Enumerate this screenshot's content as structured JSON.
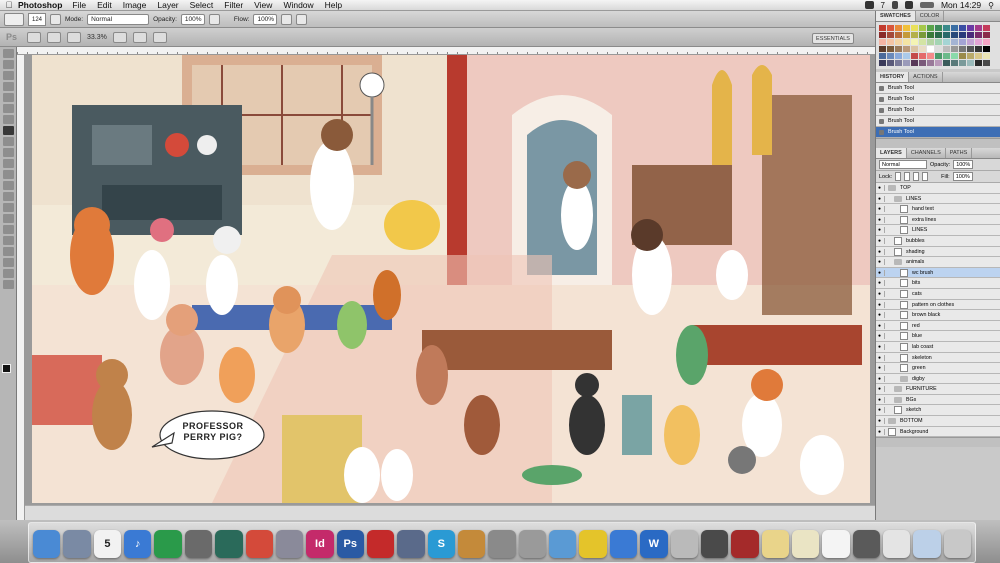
{
  "menubar": {
    "app_name": "Photoshop",
    "items": [
      "File",
      "Edit",
      "Image",
      "Layer",
      "Select",
      "Filter",
      "View",
      "Window",
      "Help"
    ],
    "clock": "Mon 14:29",
    "badge": "7"
  },
  "options_bar": {
    "brush_size": "124",
    "mode_label": "Mode:",
    "mode_value": "Normal",
    "opacity_label": "Opacity:",
    "opacity_value": "100%",
    "flow_label": "Flow:",
    "flow_value": "100%"
  },
  "app_bar": {
    "logo": "Ps",
    "zoom": "33.3%",
    "workspace": "ESSENTIALS"
  },
  "speech_bubble": "PROFESSOR PERRY PIG?",
  "panels": {
    "swatch_tabs": [
      "SWATCHES",
      "COLOR"
    ],
    "history_tabs": [
      "HISTORY",
      "ACTIONS"
    ],
    "history_items": [
      "Brush Tool",
      "Brush Tool",
      "Brush Tool",
      "Brush Tool",
      "Brush Tool"
    ],
    "layers_tabs": [
      "LAYERS",
      "CHANNELS",
      "PATHS"
    ],
    "blend_mode": "Normal",
    "opacity_label": "Opacity:",
    "opacity": "100%",
    "lock_label": "Lock:",
    "fill_label": "Fill:",
    "fill": "100%",
    "layers": [
      {
        "name": "TOP",
        "indent": 0,
        "group": true
      },
      {
        "name": "LINES",
        "indent": 1,
        "group": true
      },
      {
        "name": "hand text",
        "indent": 2
      },
      {
        "name": "extra lines",
        "indent": 2
      },
      {
        "name": "LINES",
        "indent": 2
      },
      {
        "name": "bubbles",
        "indent": 1
      },
      {
        "name": "shading",
        "indent": 1
      },
      {
        "name": "animals",
        "indent": 1,
        "group": true
      },
      {
        "name": "wc brush",
        "indent": 2,
        "selected": true
      },
      {
        "name": "bits",
        "indent": 2
      },
      {
        "name": "cats",
        "indent": 2
      },
      {
        "name": "pattern on clothes",
        "indent": 2
      },
      {
        "name": "brown black",
        "indent": 2
      },
      {
        "name": "red",
        "indent": 2
      },
      {
        "name": "blue",
        "indent": 2
      },
      {
        "name": "lab coast",
        "indent": 2
      },
      {
        "name": "skeleton",
        "indent": 2
      },
      {
        "name": "green",
        "indent": 2
      },
      {
        "name": "digby",
        "indent": 2,
        "group": true
      },
      {
        "name": "FURNITURE",
        "indent": 1,
        "group": true
      },
      {
        "name": "BGs",
        "indent": 1,
        "group": true
      },
      {
        "name": "sketch",
        "indent": 1
      },
      {
        "name": "BOTTOM",
        "indent": 0,
        "group": true
      },
      {
        "name": "Background",
        "indent": 0
      }
    ],
    "swatch_colors": [
      "#c23b2e",
      "#d9563c",
      "#e88a3a",
      "#f0c03a",
      "#e9e05a",
      "#a6c84a",
      "#5aa44a",
      "#3d8a5a",
      "#3a8a8a",
      "#3a6ea4",
      "#3a4ea4",
      "#6a3aa4",
      "#a43a8a",
      "#c43a5a",
      "#8a2a2a",
      "#a44a3a",
      "#b86a3a",
      "#c49a3a",
      "#b4b04a",
      "#7a9a3a",
      "#3a7a3a",
      "#2a6a4a",
      "#2a6a6a",
      "#2a4a7a",
      "#2a3a7a",
      "#4a2a7a",
      "#7a2a6a",
      "#8a2a4a",
      "#f4b4a4",
      "#f4c4a4",
      "#f4d4a4",
      "#f4e4a4",
      "#f4f4b4",
      "#d4e4a4",
      "#b4d4a4",
      "#a4d4b4",
      "#a4d4d4",
      "#a4b4d4",
      "#a4a4d4",
      "#c4a4d4",
      "#e4a4d4",
      "#f4a4c4",
      "#5a3a2a",
      "#7a5a3a",
      "#9a7a5a",
      "#ba9a7a",
      "#dac4a4",
      "#e9dcc4",
      "#ffffff",
      "#dddddd",
      "#bbbbbb",
      "#999999",
      "#777777",
      "#555555",
      "#333333",
      "#000000",
      "#4a6a9a",
      "#6a8aba",
      "#8aaada",
      "#aacaea",
      "#c44a4a",
      "#e46a6a",
      "#f48a8a",
      "#4a9a6a",
      "#6aba8a",
      "#8adaaa",
      "#9a8a4a",
      "#baaa6a",
      "#dac88a",
      "#eae4b4",
      "#3a3a5a",
      "#5a5a7a",
      "#7a7a9a",
      "#9a9aba",
      "#5a3a5a",
      "#7a5a7a",
      "#9a7a9a",
      "#ba9aba",
      "#3a5a5a",
      "#5a7a7a",
      "#7a9a9a",
      "#9ababa",
      "#2a2a2a",
      "#4a4a4a"
    ]
  },
  "dock_items": [
    {
      "name": "finder-icon",
      "label": "",
      "color": "#4a8ad4"
    },
    {
      "name": "preview-icon",
      "label": "",
      "color": "#7a8aa4"
    },
    {
      "name": "calendar-icon",
      "label": "5",
      "color": "#f2f2f2"
    },
    {
      "name": "itunes-icon",
      "label": "♪",
      "color": "#3a7ad4"
    },
    {
      "name": "spotify-icon",
      "label": "",
      "color": "#2a9a4a"
    },
    {
      "name": "iphoto-icon",
      "label": "",
      "color": "#6a6a6a"
    },
    {
      "name": "time-machine-icon",
      "label": "",
      "color": "#2a6a5a"
    },
    {
      "name": "chrome-icon",
      "label": "",
      "color": "#d44a3a"
    },
    {
      "name": "photo-booth-icon",
      "label": "",
      "color": "#8a8a9a"
    },
    {
      "name": "indesign-icon",
      "label": "Id",
      "color": "#c42a6a"
    },
    {
      "name": "photoshop-icon",
      "label": "Ps",
      "color": "#2a5aa4"
    },
    {
      "name": "acrobat-icon",
      "label": "",
      "color": "#c42a2a"
    },
    {
      "name": "ink-pen-icon",
      "label": "",
      "color": "#5a6a8a"
    },
    {
      "name": "skype-icon",
      "label": "S",
      "color": "#2a9ad4"
    },
    {
      "name": "pencil-icon",
      "label": "",
      "color": "#c48a3a"
    },
    {
      "name": "system-prefs-icon",
      "label": "",
      "color": "#8a8a8a"
    },
    {
      "name": "calculator-icon",
      "label": "",
      "color": "#9a9a9a"
    },
    {
      "name": "textedit-icon",
      "label": "",
      "color": "#5a9ad4"
    },
    {
      "name": "cyberduck-icon",
      "label": "",
      "color": "#e4c42a"
    },
    {
      "name": "wunderlist-icon",
      "label": "",
      "color": "#3a7ad4"
    },
    {
      "name": "word-icon",
      "label": "W",
      "color": "#2a6ac4"
    },
    {
      "name": "automator-icon",
      "label": "",
      "color": "#bababa"
    },
    {
      "name": "printer-icon",
      "label": "",
      "color": "#4a4a4a"
    },
    {
      "name": "screen-icon",
      "label": "",
      "color": "#a42a2a"
    },
    {
      "name": "stickies-icon",
      "label": "",
      "color": "#e9d48a"
    },
    {
      "name": "notes-icon",
      "label": "",
      "color": "#eae4c4"
    },
    {
      "name": "doc-icon",
      "label": "",
      "color": "#f4f4f4"
    },
    {
      "name": "window-icon",
      "label": "",
      "color": "#5a5a5a"
    },
    {
      "name": "pdf-icon",
      "label": "",
      "color": "#e4e4e4"
    },
    {
      "name": "finder-window-icon",
      "label": "",
      "color": "#bcd0e8"
    },
    {
      "name": "trash-icon",
      "label": "",
      "color": "#c8c8c8"
    }
  ]
}
